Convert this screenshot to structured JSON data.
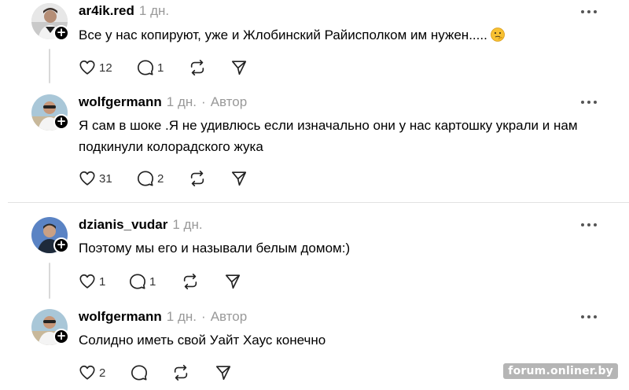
{
  "posts": [
    {
      "username": "ar4ik.red",
      "time": "1 дн.",
      "author": "",
      "text": "Все у нас копируют, уже и Жлобинский Райисполком им нужен.....",
      "emoji": "thinking-face-emoji",
      "likes": "12",
      "replies": "1",
      "avatar": "avatar-ar4ik-red"
    },
    {
      "username": "wolfgermann",
      "time": "1 дн.",
      "author": "Автор",
      "text": "Я сам в шоке .Я не удивлюсь если изначально они у нас картошку украли и нам подкинули колорадского жука",
      "likes": "31",
      "replies": "2",
      "avatar": "avatar-wolfgermann"
    },
    {
      "username": "dzianis_vudar",
      "time": "1 дн.",
      "author": "",
      "text": "Поэтому мы его и называли белым домом:)",
      "likes": "1",
      "replies": "1",
      "avatar": "avatar-dzianis-vudar"
    },
    {
      "username": "wolfgermann",
      "time": "1 дн.",
      "author": "Автор",
      "text": "Солидно иметь свой Уайт Хаус конечно",
      "likes": "2",
      "replies": "",
      "avatar": "avatar-wolfgermann"
    }
  ],
  "separator": "·",
  "watermark": "forum.onliner.by",
  "icons": {
    "like": "heart-icon",
    "reply": "speech-bubble-icon",
    "repost": "repost-icon",
    "share": "send-icon",
    "more": "more-dots-icon",
    "follow": "plus-icon"
  }
}
